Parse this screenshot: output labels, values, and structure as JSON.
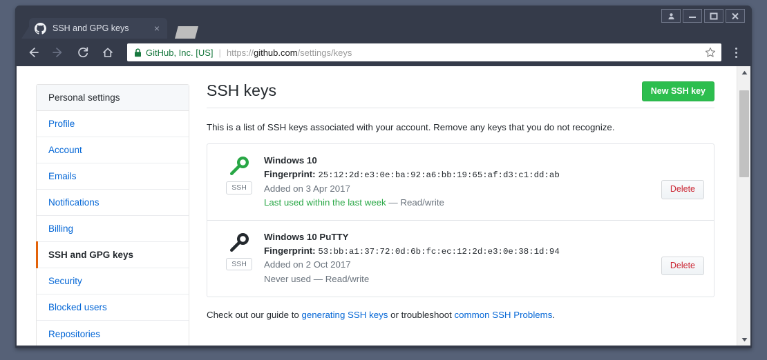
{
  "browser": {
    "tab": {
      "title": "SSH and GPG keys",
      "favicon": "github-icon",
      "close_label": "×"
    },
    "new_tab_label": "",
    "window_controls": [
      {
        "name": "profile-button",
        "glyph": "👤"
      },
      {
        "name": "minimize-button",
        "glyph": "–"
      },
      {
        "name": "maximize-button",
        "glyph": "□"
      },
      {
        "name": "close-button",
        "glyph": "✕"
      }
    ],
    "toolbar": {
      "back_label": "←",
      "forward_label": "→",
      "reload_label": "↻",
      "home_label": "⌂",
      "site_identity": "GitHub, Inc. [US]",
      "omnibox_separator": "|",
      "url_scheme": "https://",
      "url_host": "github.com",
      "url_path": "/settings/keys",
      "star_label": "☆",
      "menu_label": "⋮"
    },
    "scrollbar": {
      "up_label": "▲",
      "down_label": "▼"
    }
  },
  "sidebar": {
    "header": "Personal settings",
    "items": [
      {
        "label": "Profile",
        "selected": false
      },
      {
        "label": "Account",
        "selected": false
      },
      {
        "label": "Emails",
        "selected": false
      },
      {
        "label": "Notifications",
        "selected": false
      },
      {
        "label": "Billing",
        "selected": false
      },
      {
        "label": "SSH and GPG keys",
        "selected": true
      },
      {
        "label": "Security",
        "selected": false
      },
      {
        "label": "Blocked users",
        "selected": false
      },
      {
        "label": "Repositories",
        "selected": false
      }
    ]
  },
  "main": {
    "title": "SSH keys",
    "new_key_button": "New SSH key",
    "intro": "This is a list of SSH keys associated with your account. Remove any keys that you do not recognize.",
    "keys": [
      {
        "title": "Windows 10",
        "fingerprint_label": "Fingerprint:",
        "fingerprint": "25:12:2d:e3:0e:ba:92:a6:bb:19:65:af:d3:c1:dd:ab",
        "added": "Added on 3 Apr 2017",
        "usage_status": "Last used within the last week",
        "usage_scope": "— Read/write",
        "usage_recent": true,
        "protocol_badge": "SSH",
        "key_icon": "key-icon",
        "key_icon_color": "#28a745",
        "delete_label": "Delete"
      },
      {
        "title": "Windows 10 PuTTY",
        "fingerprint_label": "Fingerprint:",
        "fingerprint": "53:bb:a1:37:72:0d:6b:fc:ec:12:2d:e3:0e:38:1d:94",
        "added": "Added on 2 Oct 2017",
        "usage_status": "Never used",
        "usage_scope": "— Read/write",
        "usage_recent": false,
        "protocol_badge": "SSH",
        "key_icon": "key-icon",
        "key_icon_color": "#24292e",
        "delete_label": "Delete"
      }
    ],
    "footer": {
      "lead": "Check out our guide to ",
      "link1": "generating SSH keys",
      "middle": " or troubleshoot ",
      "link2": "common SSH Problems",
      "tail": "."
    }
  },
  "colors": {
    "accent_green": "#2cbe4e",
    "link_blue": "#0366d6",
    "selected_marker": "#e36209",
    "danger_red": "#cb2431",
    "chrome_bg": "#353b4a",
    "desktop_bg": "#566177"
  }
}
